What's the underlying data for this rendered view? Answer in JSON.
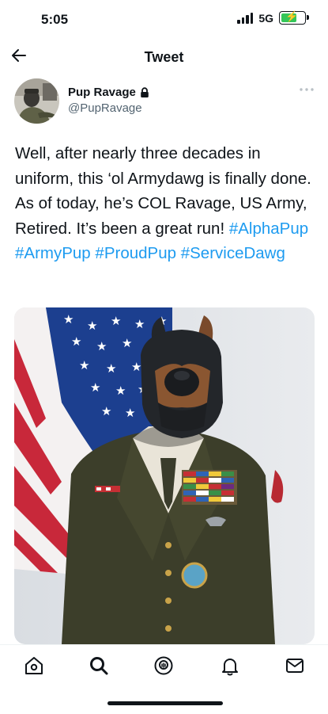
{
  "status": {
    "time": "5:05",
    "network": "5G"
  },
  "nav": {
    "title": "Tweet"
  },
  "author": {
    "name": "Pup Ravage",
    "handle": "@PupRavage"
  },
  "tweet": {
    "text": "Well, after nearly three decades in uniform, this ‘ol Armydawg is finally done. As of today, he’s COL Ravage, US Army, Retired. It’s been a great run!",
    "hashtags": [
      "#AlphaPup",
      "#ArmyPup",
      "#ProudPup",
      "#ServiceDawg"
    ]
  },
  "tabs": [
    "home-icon",
    "search-icon",
    "spaces-icon",
    "notifications-icon",
    "messages-icon"
  ],
  "colors": {
    "accent": "#1d9bf0",
    "text": "#0f1419",
    "secondary": "#536471"
  }
}
